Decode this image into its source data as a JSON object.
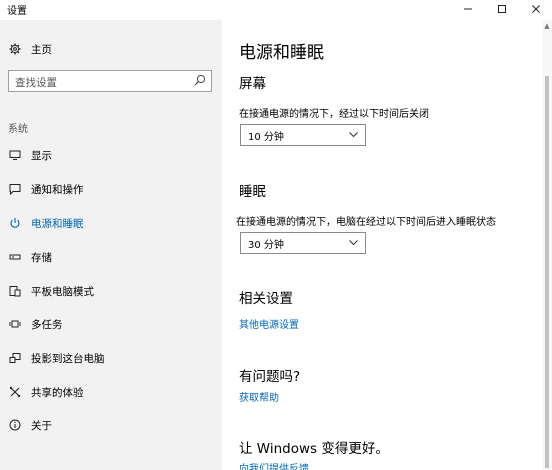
{
  "window": {
    "title": "设置",
    "minimize_icon": "minimize-icon",
    "maximize_icon": "maximize-icon",
    "close_icon": "close-icon"
  },
  "sidebar": {
    "home": {
      "label": "主页",
      "icon": "gear-icon"
    },
    "search": {
      "placeholder": "查找设置",
      "icon": "search-icon"
    },
    "section_label": "系统",
    "items": [
      {
        "label": "显示",
        "icon": "display-icon",
        "active": false
      },
      {
        "label": "通知和操作",
        "icon": "notification-icon",
        "active": false
      },
      {
        "label": "电源和睡眠",
        "icon": "power-icon",
        "active": true
      },
      {
        "label": "存储",
        "icon": "storage-icon",
        "active": false
      },
      {
        "label": "平板电脑模式",
        "icon": "tablet-mode-icon",
        "active": false
      },
      {
        "label": "多任务",
        "icon": "multitasking-icon",
        "active": false
      },
      {
        "label": "投影到这台电脑",
        "icon": "project-icon",
        "active": false
      },
      {
        "label": "共享的体验",
        "icon": "shared-experience-icon",
        "active": false
      },
      {
        "label": "关于",
        "icon": "info-icon",
        "active": false
      }
    ]
  },
  "main": {
    "title": "电源和睡眠",
    "screen": {
      "heading": "屏幕",
      "description": "在接通电源的情况下，经过以下时间后关闭",
      "value": "10 分钟"
    },
    "sleep": {
      "heading": "睡眠",
      "description": "在接通电源的情况下，电脑在经过以下时间后进入睡眠状态",
      "value": "30 分钟"
    },
    "related": {
      "heading": "相关设置",
      "link": "其他电源设置"
    },
    "question": {
      "heading": "有问题吗?",
      "link": "获取帮助"
    },
    "feedback": {
      "heading": "让 Windows 变得更好。",
      "link": "向我们提供反馈"
    }
  },
  "colors": {
    "accent": "#0067b8",
    "sidebar_bg": "#f2f2f2",
    "content_bg": "#ffffff"
  }
}
